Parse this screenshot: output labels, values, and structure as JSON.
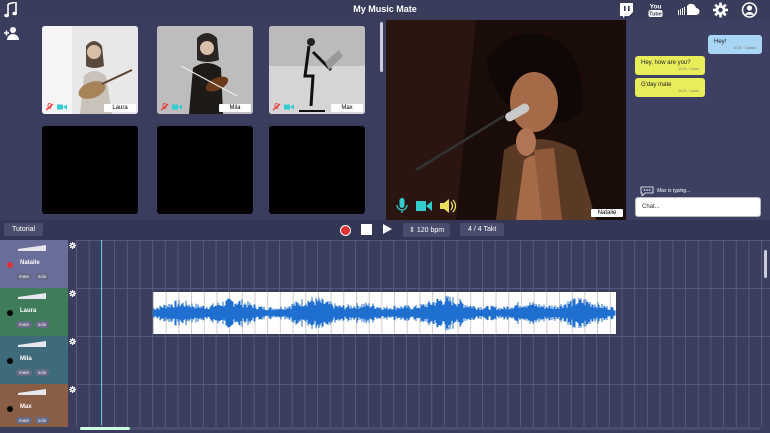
{
  "app": {
    "title": "My Music Mate"
  },
  "header_icons": [
    "twitch-icon",
    "youtube-icon",
    "soundcloud-icon",
    "gear-icon",
    "profile-icon"
  ],
  "header_icon_labels": {
    "youtube": "You Tube"
  },
  "participants": [
    {
      "name": "Laura"
    },
    {
      "name": "Mila"
    },
    {
      "name": "Max"
    }
  ],
  "main_video": {
    "name": "Natalie"
  },
  "chat": {
    "messages": [
      {
        "text": "Hey!",
        "time": "10:30 · Natalie",
        "side": "right"
      },
      {
        "text": "Hey, how are you?",
        "time": "10:31 · Laura",
        "side": "left"
      },
      {
        "text": "G'day mate",
        "time": "10:31 · Laura",
        "side": "left"
      }
    ],
    "typing": "Max is typing...",
    "placeholder": "Chat..."
  },
  "transport": {
    "tutorial_label": "Tutorial",
    "bpm": "120 bpm",
    "takt": "4 / 4 Takt"
  },
  "tracks": [
    {
      "name": "Natalie",
      "mute": "mute",
      "solo": "solo",
      "color": "#6a6e9a",
      "dot": "#d33"
    },
    {
      "name": "Laura",
      "mute": "mute",
      "solo": "solo",
      "color": "#3f7d5a",
      "dot": "#000"
    },
    {
      "name": "Mila",
      "mute": "mute",
      "solo": "solo",
      "color": "#3e6b7a",
      "dot": "#000"
    },
    {
      "name": "Max",
      "mute": "mute",
      "solo": "solo",
      "color": "#8a5e44",
      "dot": "#000"
    }
  ],
  "colors": {
    "accent": "#5ec8d8",
    "waveform": "#1e6fd0",
    "record": "#dd3333",
    "chat_self": "#a9d6f5",
    "chat_other": "#e8ed5a"
  }
}
